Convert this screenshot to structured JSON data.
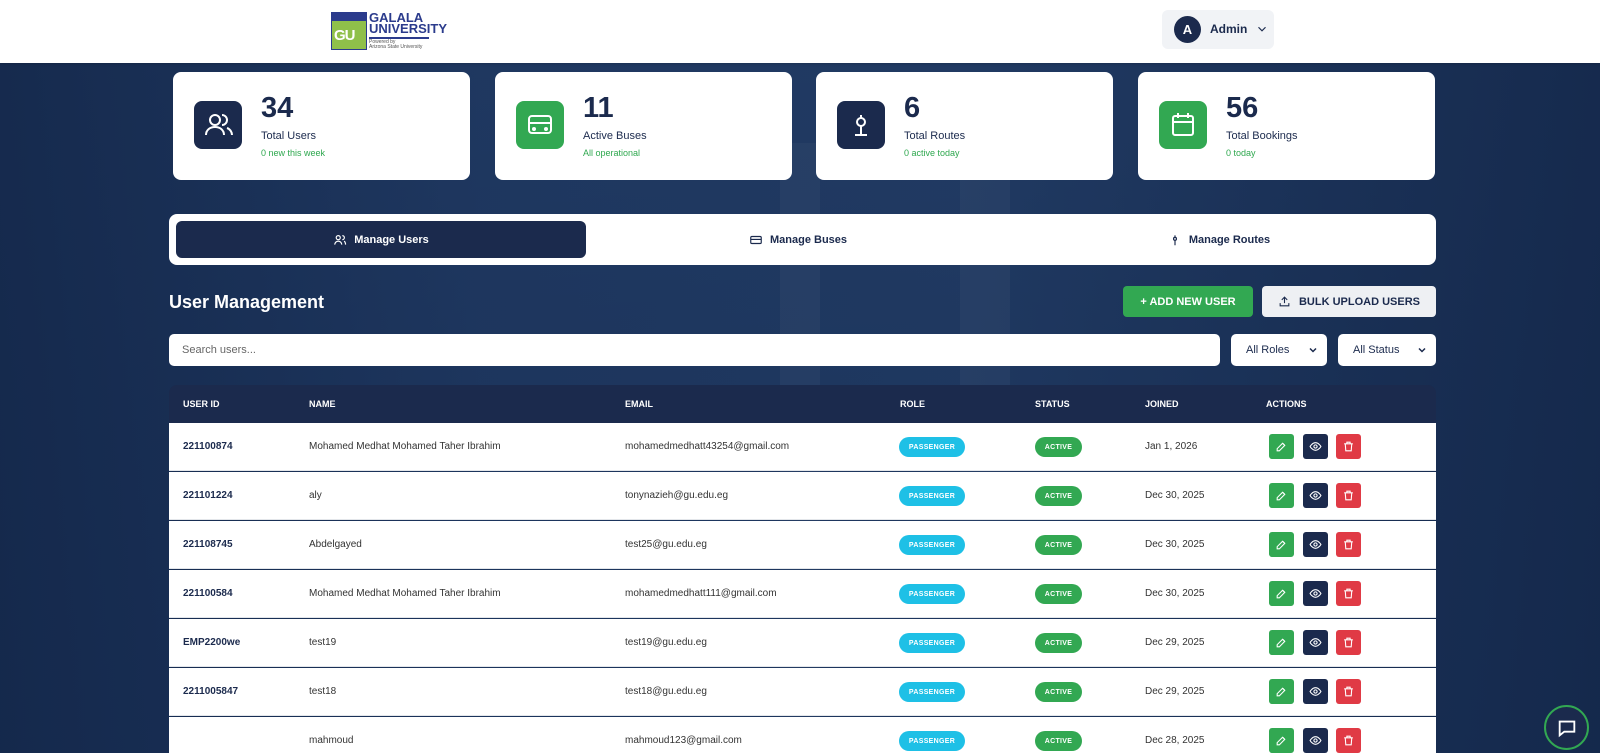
{
  "brand": {
    "line1": "GALALA",
    "line2": "UNIVERSITY",
    "mark": "GU",
    "powered": "Powered by",
    "asu": "Arizona State University"
  },
  "user": {
    "initial": "A",
    "name": "Admin"
  },
  "stats": [
    {
      "value": "34",
      "label": "Total Users",
      "sub": "0 new this week",
      "icon": "users-icon",
      "color": "#1b2a4d"
    },
    {
      "value": "11",
      "label": "Active Buses",
      "sub": "All operational",
      "icon": "bus-icon",
      "color": "#32a852"
    },
    {
      "value": "6",
      "label": "Total Routes",
      "sub": "0 active today",
      "icon": "route-pin-icon",
      "color": "#1b2a4d"
    },
    {
      "value": "56",
      "label": "Total Bookings",
      "sub": "0 today",
      "icon": "calendar-icon",
      "color": "#32a852"
    }
  ],
  "tabs": [
    {
      "label": "Manage Users",
      "icon": "users-icon"
    },
    {
      "label": "Manage Buses",
      "icon": "bus-icon"
    },
    {
      "label": "Manage Routes",
      "icon": "route-pin-icon"
    }
  ],
  "section": {
    "title": "User Management",
    "add_label": "+ ADD NEW USER",
    "bulk_label": "BULK UPLOAD USERS",
    "search_placeholder": "Search users...",
    "roles_filter": "All Roles",
    "status_filter": "All Status"
  },
  "table": {
    "headers": [
      "USER ID",
      "NAME",
      "EMAIL",
      "ROLE",
      "STATUS",
      "JOINED",
      "ACTIONS"
    ],
    "rows": [
      {
        "id": "221100874",
        "name": "Mohamed Medhat Mohamed Taher Ibrahim",
        "email": "mohamedmedhatt43254@gmail.com",
        "role": "PASSENGER",
        "status": "ACTIVE",
        "joined": "Jan 1, 2026"
      },
      {
        "id": "221101224",
        "name": "aly",
        "email": "tonynazieh@gu.edu.eg",
        "role": "PASSENGER",
        "status": "ACTIVE",
        "joined": "Dec 30, 2025"
      },
      {
        "id": "221108745",
        "name": "Abdelgayed",
        "email": "test25@gu.edu.eg",
        "role": "PASSENGER",
        "status": "ACTIVE",
        "joined": "Dec 30, 2025"
      },
      {
        "id": "221100584",
        "name": "Mohamed Medhat Mohamed Taher Ibrahim",
        "email": "mohamedmedhatt111@gmail.com",
        "role": "PASSENGER",
        "status": "ACTIVE",
        "joined": "Dec 30, 2025"
      },
      {
        "id": "EMP2200we",
        "name": "test19",
        "email": "test19@gu.edu.eg",
        "role": "PASSENGER",
        "status": "ACTIVE",
        "joined": "Dec 29, 2025"
      },
      {
        "id": "2211005847",
        "name": "test18",
        "email": "test18@gu.edu.eg",
        "role": "PASSENGER",
        "status": "ACTIVE",
        "joined": "Dec 29, 2025"
      },
      {
        "id": "",
        "name": "mahmoud",
        "email": "mahmoud123@gmail.com",
        "role": "PASSENGER",
        "status": "ACTIVE",
        "joined": "Dec 28, 2025"
      }
    ]
  },
  "colors": {
    "navy": "#1b2a4d",
    "green": "#32a852",
    "cyan": "#1ec0e6",
    "red": "#e03a45"
  }
}
